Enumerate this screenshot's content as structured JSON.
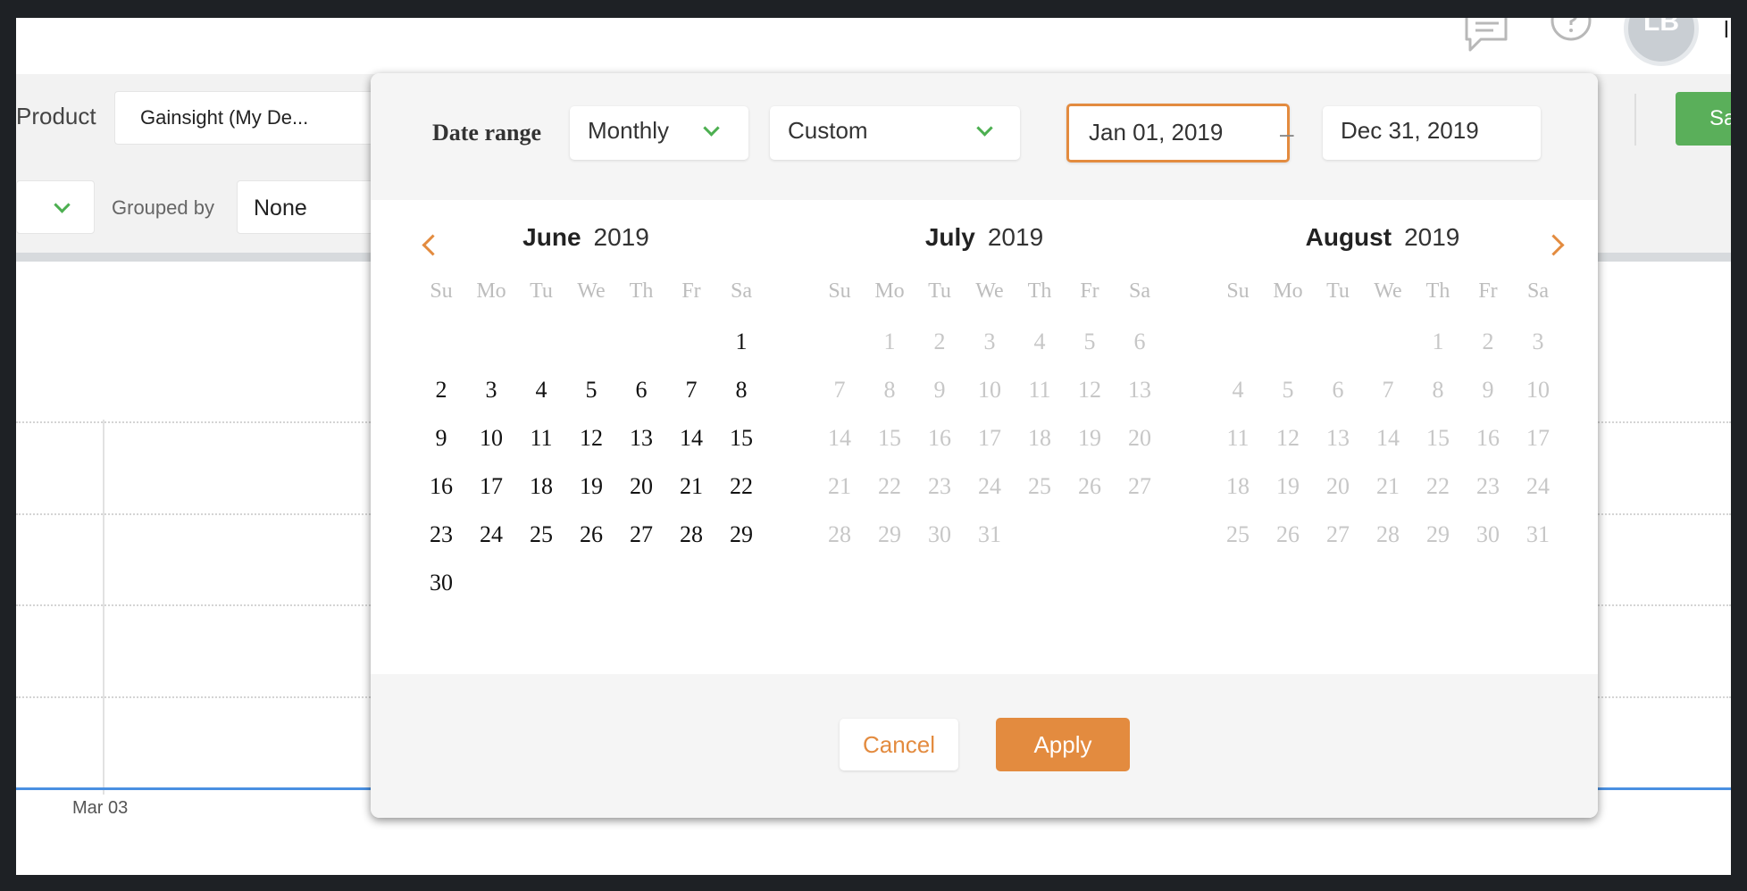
{
  "topbar": {
    "avatar_initials": "LB",
    "partial_label": "l",
    "icons": [
      "chat-icon",
      "help-icon"
    ]
  },
  "filters": {
    "product_label": "Product",
    "product_value": "Gainsight (My De...",
    "grouped_by_label": "Grouped by",
    "grouped_by_value": "None",
    "save_label": "Sav"
  },
  "chart": {
    "x_tick": "Mar 03"
  },
  "picker": {
    "date_range_label": "Date range",
    "granularity": "Monthly",
    "preset": "Custom",
    "from_date": "Jan 01, 2019",
    "separator": "–",
    "to_date": "Dec 31, 2019",
    "weekday_labels": [
      "Su",
      "Mo",
      "Tu",
      "We",
      "Th",
      "Fr",
      "Sa"
    ],
    "months": [
      {
        "name": "June",
        "year": "2019",
        "weeks": [
          [
            "",
            "",
            "",
            "",
            "",
            "",
            "1"
          ],
          [
            "2",
            "3",
            "4",
            "5",
            "6",
            "7",
            "8"
          ],
          [
            "9",
            "10",
            "11",
            "12",
            "13",
            "14",
            "15"
          ],
          [
            "16",
            "17",
            "18",
            "19",
            "20",
            "21",
            "22"
          ],
          [
            "23",
            "24",
            "25",
            "26",
            "27",
            "28",
            "29"
          ],
          [
            "30",
            "",
            "",
            "",
            "",
            "",
            ""
          ]
        ],
        "enabled": true
      },
      {
        "name": "July",
        "year": "2019",
        "weeks": [
          [
            "",
            "1",
            "2",
            "3",
            "4",
            "5",
            "6"
          ],
          [
            "7",
            "8",
            "9",
            "10",
            "11",
            "12",
            "13"
          ],
          [
            "14",
            "15",
            "16",
            "17",
            "18",
            "19",
            "20"
          ],
          [
            "21",
            "22",
            "23",
            "24",
            "25",
            "26",
            "27"
          ],
          [
            "28",
            "29",
            "30",
            "31",
            "",
            "",
            ""
          ]
        ],
        "enabled": false
      },
      {
        "name": "August",
        "year": "2019",
        "weeks": [
          [
            "",
            "",
            "",
            "",
            "1",
            "2",
            "3"
          ],
          [
            "4",
            "5",
            "6",
            "7",
            "8",
            "9",
            "10"
          ],
          [
            "11",
            "12",
            "13",
            "14",
            "15",
            "16",
            "17"
          ],
          [
            "18",
            "19",
            "20",
            "21",
            "22",
            "23",
            "24"
          ],
          [
            "25",
            "26",
            "27",
            "28",
            "29",
            "30",
            "31"
          ]
        ],
        "enabled": false
      }
    ],
    "cancel_label": "Cancel",
    "apply_label": "Apply"
  },
  "colors": {
    "accent_orange": "#e38b3f",
    "chevron_green": "#4caf50",
    "save_green": "#5aaf5a",
    "axis_blue": "#4a90e2"
  }
}
